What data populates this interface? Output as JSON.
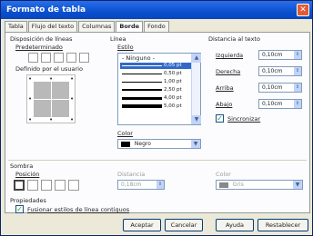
{
  "window": {
    "title": "Formato de tabla",
    "close_glyph": "✕"
  },
  "tabs": [
    {
      "label": "Tabla"
    },
    {
      "label": "Flujo del texto"
    },
    {
      "label": "Columnas"
    },
    {
      "label": "Borde"
    },
    {
      "label": "Fondo"
    }
  ],
  "line_arrangement": {
    "heading": "Disposición de líneas",
    "default_label": "Predeterminado",
    "user_defined_label": "Definido por el usuario"
  },
  "line": {
    "heading": "Línea",
    "style_label": "Estilo",
    "styles": [
      {
        "label": "- Ninguno -",
        "pt": ""
      },
      {
        "label": "",
        "pt": "0,05 pt"
      },
      {
        "label": "",
        "pt": "0,50 pt"
      },
      {
        "label": "",
        "pt": "1,00 pt"
      },
      {
        "label": "",
        "pt": "2,50 pt"
      },
      {
        "label": "",
        "pt": "4,00 pt"
      },
      {
        "label": "",
        "pt": "5,00 pt"
      }
    ],
    "color_label": "Color",
    "color_value": "Negro"
  },
  "spacing": {
    "heading": "Distancia al texto",
    "left_label": "Izquierda",
    "left_value": "0,10cm",
    "right_label": "Derecha",
    "right_value": "0,10cm",
    "top_label": "Arriba",
    "top_value": "0,10cm",
    "bottom_label": "Abajo",
    "bottom_value": "0,10cm",
    "sync_label": "Sincronizar"
  },
  "shadow": {
    "heading": "Sombra",
    "position_label": "Posición",
    "distance_label": "Distancia",
    "distance_value": "0,18cm",
    "color_label": "Color",
    "color_value": "Gris"
  },
  "properties": {
    "heading": "Propiedades",
    "merge_label": "Fusionar estilos de línea contiguos"
  },
  "buttons": {
    "ok": "Aceptar",
    "cancel": "Cancelar",
    "help": "Ayuda",
    "reset": "Restablecer"
  },
  "colors": {
    "title_bar": "#0a50d0",
    "selected": "#316ac5",
    "panel_bg": "#fcfcfe"
  }
}
